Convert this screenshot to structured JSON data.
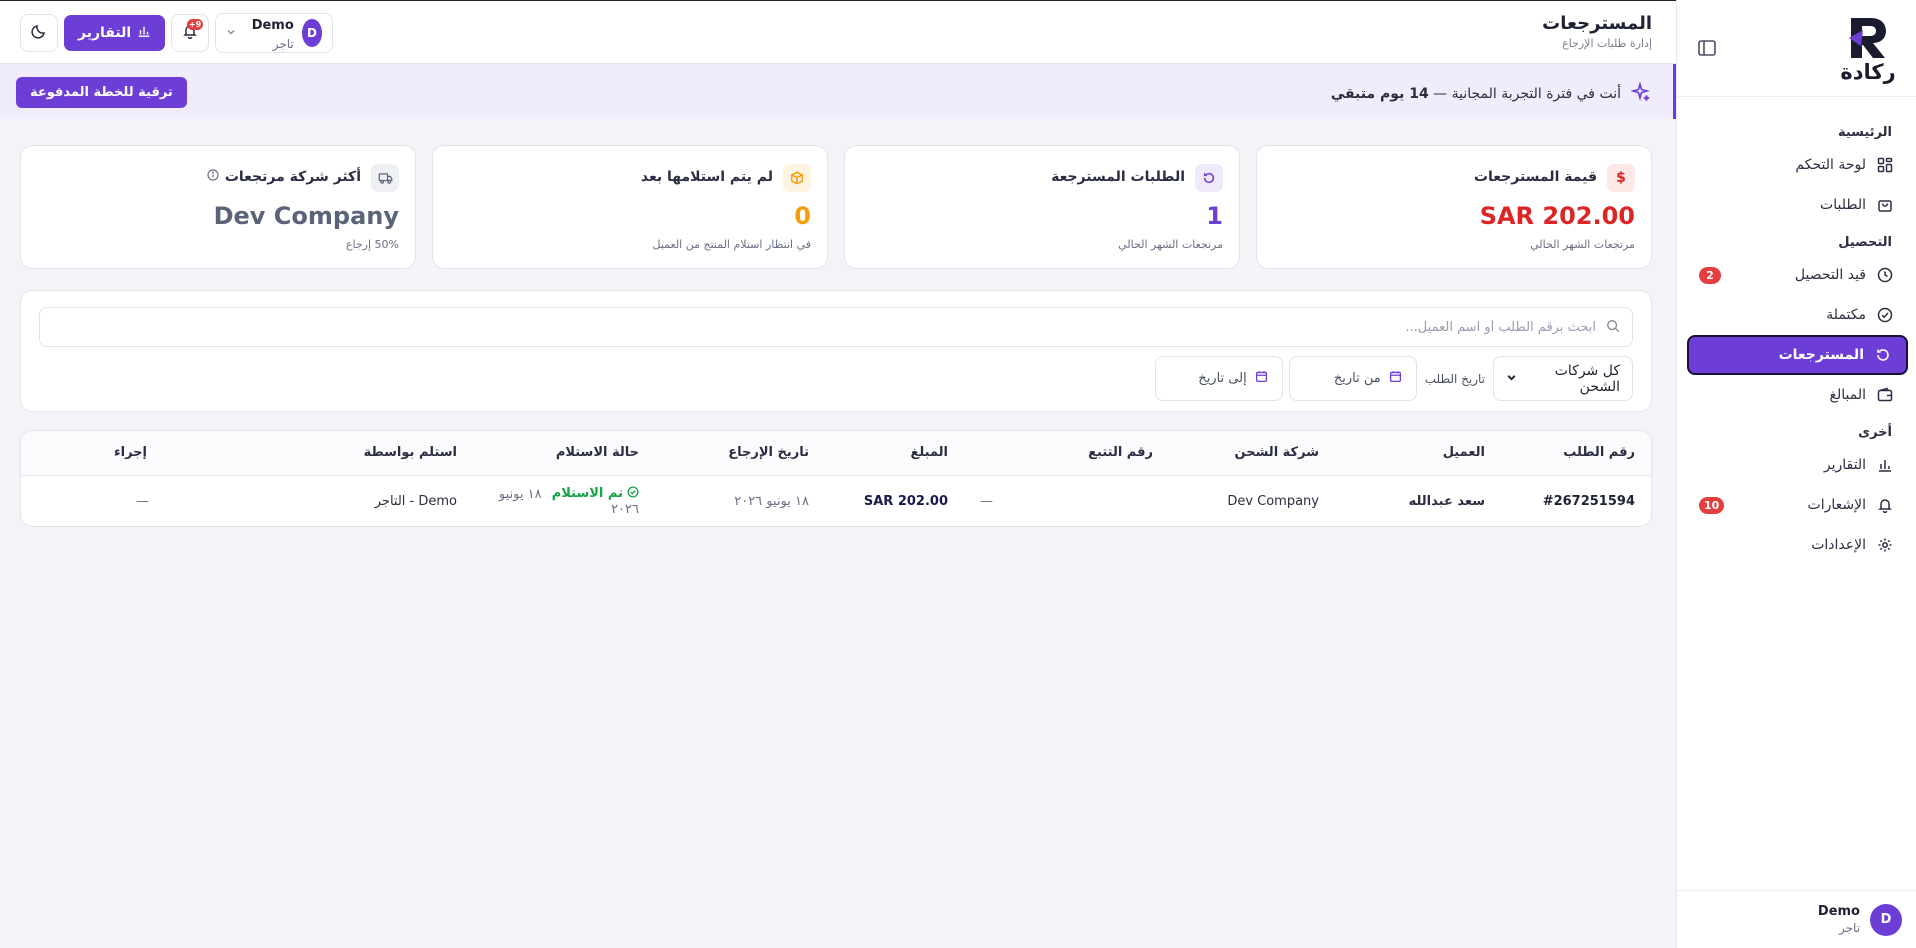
{
  "sidebar": {
    "brand": "ركادة",
    "sections": [
      {
        "title": "الرئيسية",
        "items": [
          {
            "label": "لوحة التحكم",
            "icon": "grid-icon"
          },
          {
            "label": "الطلبات",
            "icon": "bag-icon"
          }
        ]
      },
      {
        "title": "التحصيل",
        "items": [
          {
            "label": "قيد التحصيل",
            "icon": "clock-icon",
            "badge": "2"
          },
          {
            "label": "مكتملة",
            "icon": "check-circle-icon"
          },
          {
            "label": "المسترجعات",
            "icon": "undo-icon",
            "active": true
          },
          {
            "label": "المبالغ",
            "icon": "wallet-icon"
          }
        ]
      },
      {
        "title": "أخرى",
        "items": [
          {
            "label": "التقارير",
            "icon": "bar-chart-icon"
          },
          {
            "label": "الإشعارات",
            "icon": "bell-icon",
            "badge": "10"
          },
          {
            "label": "الإعدادات",
            "icon": "gear-icon"
          }
        ]
      }
    ],
    "user": {
      "initial": "D",
      "name": "Demo",
      "role": "تاجر"
    }
  },
  "topbar": {
    "title": "المسترجعات",
    "subtitle": "إدارة طلبات الإرجاع",
    "reports_label": "التقارير",
    "notif_badge": "9+",
    "user": {
      "initial": "D",
      "name": "Demo",
      "role": "تاجر"
    }
  },
  "trial": {
    "text_prefix": "أنت في فترة التجربة المجانية —",
    "days": "14 يوم متبقي",
    "upgrade_label": "ترقية للخطة المدفوعة"
  },
  "stats": [
    {
      "label": "قيمة المسترجعات",
      "value": "SAR 202.00",
      "sub": "مرتجعات الشهر الحالي",
      "icon": "dollar-icon",
      "color": "#dc2626",
      "bg": "#fde8e8"
    },
    {
      "label": "الطلبات المسترجعة",
      "value": "1",
      "sub": "مرتجعات الشهر الحالي",
      "icon": "undo-icon",
      "color": "#6d3ed6",
      "bg": "#efe9fb"
    },
    {
      "label": "لم يتم استلامها بعد",
      "value": "0",
      "sub": "في انتظار استلام المنتج من العميل",
      "icon": "box-icon",
      "color": "#f59e0b",
      "bg": "#fdf3e1"
    },
    {
      "label": "أكثر شركة مرتجعات",
      "value": "Dev Company",
      "sub": "50% إرجاع",
      "icon": "truck-icon",
      "color": "#5b6378",
      "bg": "#eef0f4"
    }
  ],
  "filters": {
    "search_placeholder": "ابحث برقم الطلب أو اسم العميل...",
    "carrier_selected": "كل شركات الشحن",
    "order_date_label": "تاريخ الطلب",
    "from_date": "من تاريخ",
    "to_date": "إلى تاريخ"
  },
  "table": {
    "headers": [
      "رقم الطلب",
      "العميل",
      "شركة الشحن",
      "رقم التتبع",
      "المبلغ",
      "تاريخ الإرجاع",
      "حالة الاستلام",
      "استلم بواسطة",
      "إجراء"
    ],
    "rows": [
      {
        "order_id": "#267251594",
        "customer": "سعد عبدالله",
        "carrier": "Dev Company",
        "tracking": "—",
        "amount": "SAR 202.00",
        "return_date": "١٨ يونيو ٢٠٢٦",
        "status": "تم الاستلام",
        "status_date": "١٨ يونيو ٢٠٢٦",
        "received_by": "Demo - التاجر",
        "action": "—"
      }
    ]
  }
}
